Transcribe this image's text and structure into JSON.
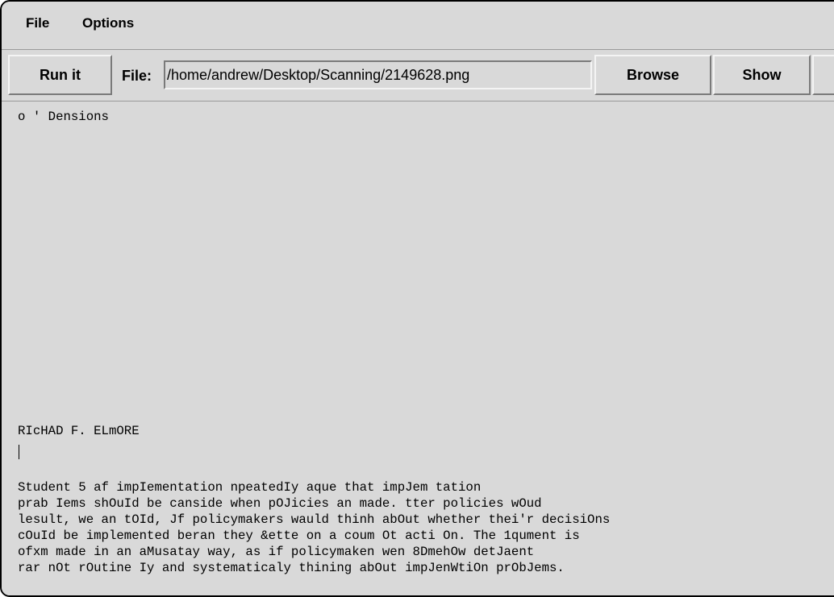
{
  "menu": {
    "file": "File",
    "options": "Options"
  },
  "toolbar": {
    "run_label": "Run it",
    "file_label": "File:",
    "file_path": "/home/andrew/Desktop/Scanning/2149628.png",
    "browse_label": "Browse",
    "show_label": "Show",
    "extra_label": ""
  },
  "output": {
    "lines": [
      "o ' Densions",
      "RIcHAD F. ELmORE",
      "Student 5 af impIementation npeatedIy aque that impJem tation",
      "prab Iems shOuId be canside when pOJicies an made. tter policies wOud",
      "lesult, we an tOId, Jf policymakers wauld thinh abOut whether thei'r decisiOns",
      "cOuId be implemented beran they &ette on a coum Ot acti On. The 1qument is",
      "ofxm made in an aMusatay way, as if policymaken wen 8DmehOw detJaent",
      "rar nOt rOutine Iy and systematicaly thining abOut impJenWtiOn prObJems."
    ]
  }
}
